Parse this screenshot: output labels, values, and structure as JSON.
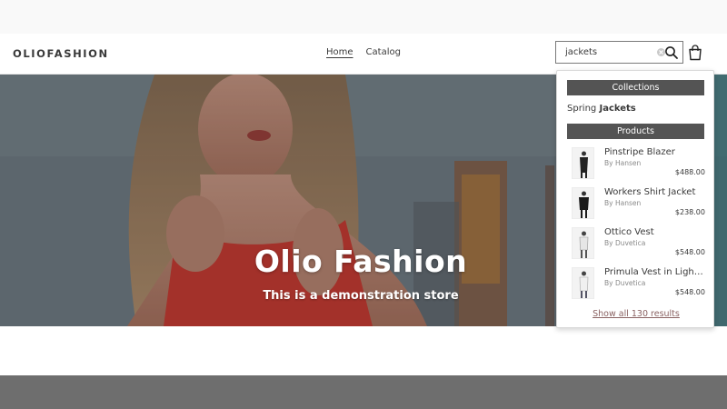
{
  "brand": {
    "logo_text": "OLIOFASHION"
  },
  "nav": {
    "items": [
      {
        "label": "Home",
        "active": true
      },
      {
        "label": "Catalog",
        "active": false
      }
    ]
  },
  "search": {
    "value": "jackets",
    "placeholder": "Search"
  },
  "hero": {
    "title": "Olio Fashion",
    "subtitle": "This is a demonstration store"
  },
  "dropdown": {
    "collections_header": "Collections",
    "collection_prefix": "Spring",
    "collection_match": "Jackets",
    "products_header": "Products",
    "products": [
      {
        "name": "Pinstripe Blazer",
        "vendor": "By Hansen",
        "price": "$488.00"
      },
      {
        "name": "Workers Shirt Jacket",
        "vendor": "By Hansen",
        "price": "$238.00"
      },
      {
        "name": "Ottico Vest",
        "vendor": "By Duvetica",
        "price": "$548.00"
      },
      {
        "name": "Primula Vest in Light …",
        "vendor": "By Duvetica",
        "price": "$548.00"
      }
    ],
    "show_all_label": "Show all 130 results"
  },
  "colors": {
    "accent_header": "#545454",
    "link_muted": "#8a6262",
    "footer_band": "#6e6e6e"
  },
  "icons": {
    "search": "search-icon",
    "clear": "clear-icon",
    "cart": "cart-icon"
  }
}
